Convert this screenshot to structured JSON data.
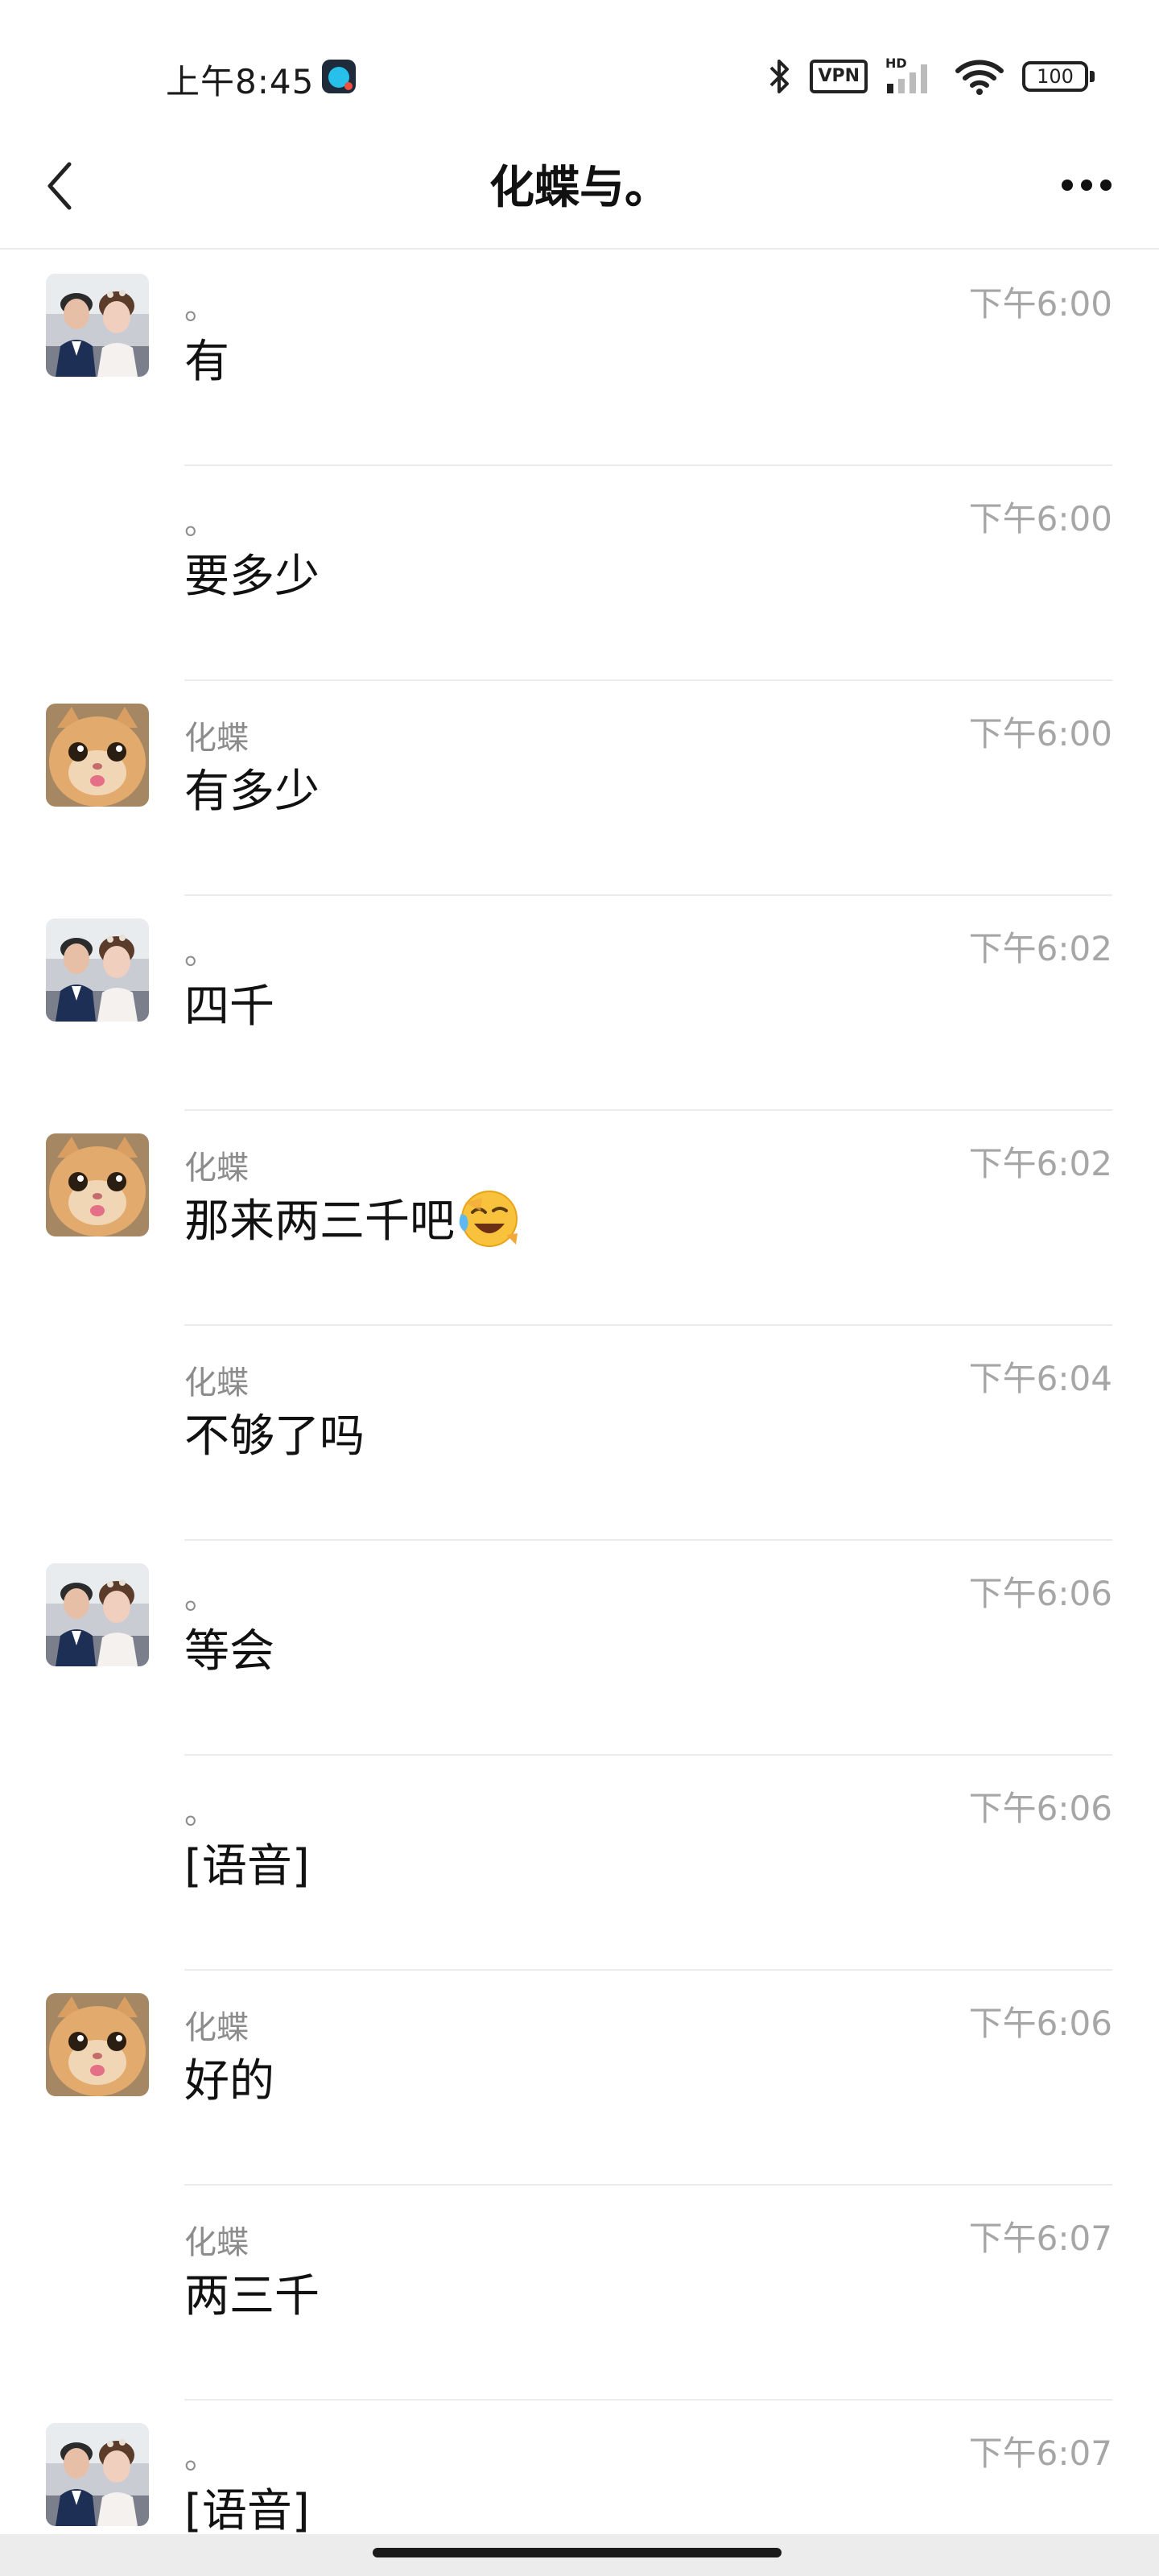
{
  "status_bar": {
    "time": "上午8:45",
    "vpn_label": "VPN",
    "hd_label": "HD",
    "battery_level": "100",
    "icons": [
      "app-notification-icon",
      "bluetooth-icon",
      "vpn-icon",
      "signal-icon",
      "wifi-icon",
      "battery-icon"
    ]
  },
  "nav": {
    "title": "化蝶与。",
    "back_icon": "chevron-left-icon",
    "more_icon": "more-dots-icon"
  },
  "messages": [
    {
      "sender": "。",
      "avatar": "couple-avatar",
      "time": "下午6:00",
      "text": "有"
    },
    {
      "sender": "。",
      "avatar": "",
      "time": "下午6:00",
      "text": "要多少"
    },
    {
      "sender": "化蝶",
      "avatar": "cat-avatar",
      "time": "下午6:00",
      "text": "有多少"
    },
    {
      "sender": "。",
      "avatar": "couple-avatar",
      "time": "下午6:02",
      "text": "四千"
    },
    {
      "sender": "化蝶",
      "avatar": "cat-avatar",
      "time": "下午6:02",
      "text": "那来两三千吧",
      "emoji": "laugh-cry-emoji"
    },
    {
      "sender": "化蝶",
      "avatar": "",
      "time": "下午6:04",
      "text": "不够了吗"
    },
    {
      "sender": "。",
      "avatar": "couple-avatar",
      "time": "下午6:06",
      "text": "等会"
    },
    {
      "sender": "。",
      "avatar": "",
      "time": "下午6:06",
      "text": "[语音]"
    },
    {
      "sender": "化蝶",
      "avatar": "cat-avatar",
      "time": "下午6:06",
      "text": "好的"
    },
    {
      "sender": "化蝶",
      "avatar": "",
      "time": "下午6:07",
      "text": "两三千"
    },
    {
      "sender": "。",
      "avatar": "couple-avatar",
      "time": "下午6:07",
      "text": "[语音]"
    }
  ]
}
